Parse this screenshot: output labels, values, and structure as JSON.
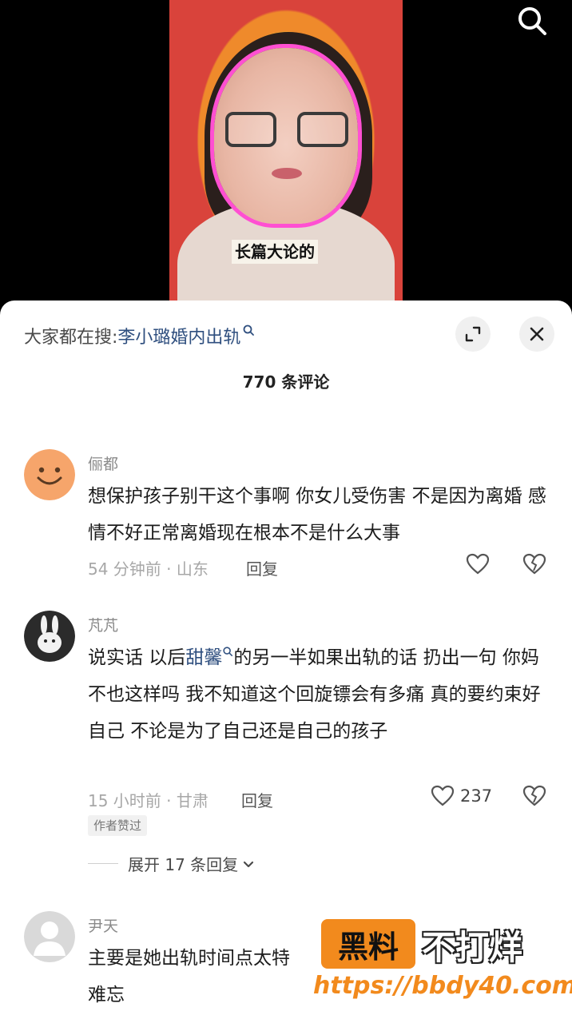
{
  "video": {
    "subtitle": "长篇大论的"
  },
  "sheet": {
    "search_prefix": "大家都在搜:",
    "search_term": "李小璐婚内出轨",
    "comment_count_title": "770 条评论"
  },
  "comments": [
    {
      "user": "俪都",
      "text": "想保护孩子别干这个事啊 你女儿受伤害 不是因为离婚 感情不好正常离婚现在根本不是什么大事",
      "meta": "54 分钟前 · 山东",
      "reply_label": "回复",
      "likes": ""
    },
    {
      "user": "芃芃",
      "text_before": "说实话 以后",
      "link_word": "甜馨",
      "text_after": "的另一半如果出轨的话 扔出一句 你妈不也这样吗 我不知道这个回旋镖会有多痛 真的要约束好自己 不论是为了自己还是自己的孩子",
      "meta": "15 小时前 · 甘肃",
      "reply_label": "回复",
      "likes": "237",
      "badge": "作者赞过",
      "expand_label": "展开 17 条回复"
    },
    {
      "user": "尹天",
      "text": "主要是她出轨时间点太特",
      "text_line2": "难忘"
    }
  ],
  "watermark": {
    "box_text": "黑料",
    "rest_text": "不打烊",
    "url": "https://bbdy40.com"
  }
}
